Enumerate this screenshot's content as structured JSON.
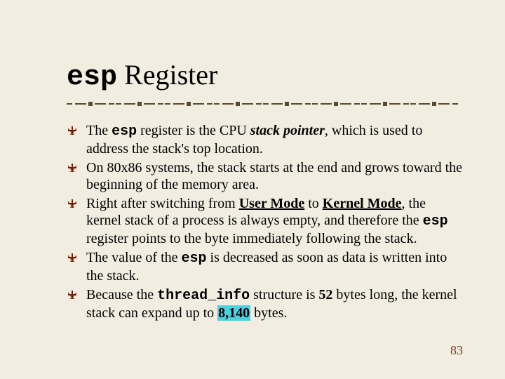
{
  "title": {
    "esp": "esp",
    "rest": " Register"
  },
  "bullets": [
    {
      "t1": "The ",
      "esp": "esp",
      "t2": " register is the CPU ",
      "sp": "stack pointer",
      "t3": ", which is used to address the stack's top location."
    },
    {
      "full": "On 80x86 systems, the stack starts at the end and grows toward the beginning of the memory area."
    },
    {
      "t1": "Right after switching from ",
      "um": "User Mode",
      "t2": " to ",
      "km": "Kernel Mode",
      "t3": ", the kernel stack of a process is always empty, and therefore the ",
      "esp": "esp",
      "t4": " register points to the byte immediately following the stack."
    },
    {
      "t1": "The value of the ",
      "esp": "esp",
      "t2": " is decreased as soon as data is written into the stack."
    },
    {
      "t1": "Because the ",
      "ti": "thread_info",
      "t2": " structure is ",
      "n52": "52",
      "t3": " bytes long, the kernel stack can expand up to ",
      "n8140": "8,140",
      "t4": " bytes."
    }
  ],
  "pagenum": "83"
}
